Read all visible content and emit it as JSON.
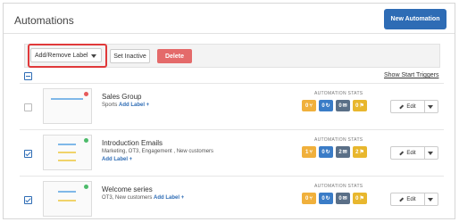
{
  "header": {
    "title": "Automations",
    "new_button": "New Automation"
  },
  "toolbar": {
    "label_select": "Add/Remove Label",
    "set_inactive": "Set Inactive",
    "delete": "Delete"
  },
  "list": {
    "show_triggers": "Show Start Triggers",
    "stats_title": "AUTOMATION STATS",
    "edit_label": "Edit"
  },
  "automations": [
    {
      "name": "Sales Group",
      "labels": "Sports",
      "add_label": "Add Label +",
      "checked": false,
      "status_color": "#e65a5a",
      "stats": {
        "contacts": "0",
        "active": "0",
        "emails": "0",
        "goals": "0"
      }
    },
    {
      "name": "Introduction Emails",
      "labels": "Marketing, OT3, Engagement , New customers",
      "add_label": "Add Label +",
      "checked": true,
      "status_color": "#4cbb6a",
      "stats": {
        "contacts": "1",
        "active": "0",
        "emails": "2",
        "goals": "2"
      }
    },
    {
      "name": "Welcome series",
      "labels": "OT3, New customers",
      "add_label": "Add Label +",
      "checked": true,
      "status_color": "#4cbb6a",
      "stats": {
        "contacts": "0",
        "active": "0",
        "emails": "0",
        "goals": "0"
      }
    }
  ],
  "colors": {
    "primary": "#2e6cb5",
    "danger": "#e46a6a",
    "highlight": "#e0393a"
  },
  "icons": {
    "contacts": "branch-icon",
    "active": "refresh-icon",
    "emails": "envelope-icon",
    "goals": "flag-icon"
  }
}
